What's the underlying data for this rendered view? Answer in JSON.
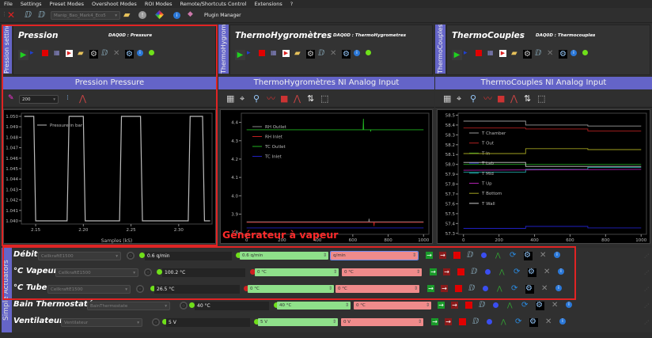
{
  "menu": [
    "File",
    "Settings",
    "Preset Modes",
    "Overshoot Modes",
    "ROI Modes",
    "Remote/Shortcuts Control",
    "Extensions",
    "?"
  ],
  "toolbar": {
    "preset_value": "Manip_Bao_Mark4_Eco5",
    "plugin_manager": "Plugin Manager"
  },
  "panels": [
    {
      "tab": "Pression settings",
      "title": "Pression",
      "daq": "DAQ0D : Pressure",
      "banner": "Pression Pressure",
      "refresh": "200"
    },
    {
      "tab": "ThermoHygromètres",
      "title": "ThermoHygromètres",
      "daq": "DAQ0D : ThermoHygrometres",
      "banner": "ThermoHygromètres NI Analog Input"
    },
    {
      "tab": "ThermoCouples settings",
      "title": "ThermoCouples",
      "daq": "DAQ0D : Thermocouples",
      "banner": "ThermoCouples NI Analog Input"
    }
  ],
  "annotation": "Générateur à vapeur",
  "chart_data": [
    {
      "type": "line",
      "xlabel": "Samples (kS)",
      "xlim": [
        2.135,
        2.335
      ],
      "ylim": [
        1.0397,
        1.0503
      ],
      "xticks": [
        2.15,
        2.2,
        2.25,
        2.3
      ],
      "xtick_labels": [
        "2.15",
        "2.20",
        "2.25",
        "2.30"
      ],
      "yticks": [
        1.04,
        1.041,
        1.042,
        1.043,
        1.044,
        1.045,
        1.046,
        1.047,
        1.048,
        1.049,
        1.05
      ],
      "ytick_labels": [
        "1.040",
        "1.041",
        "1.042",
        "1.043",
        "1.044",
        "1.045",
        "1.046",
        "1.047",
        "1.048",
        "1.049",
        "1.050"
      ],
      "legend": "top-left",
      "series": [
        {
          "name": "Pressure in bar",
          "color": "#bbbbbb",
          "x": [
            2.138,
            2.148,
            2.15,
            2.183,
            2.185,
            2.2,
            2.202,
            2.238,
            2.24,
            2.26,
            2.262,
            2.31,
            2.312,
            2.325,
            2.327,
            2.333
          ],
          "y": [
            1.05,
            1.05,
            1.04,
            1.04,
            1.05,
            1.05,
            1.04,
            1.04,
            1.05,
            1.05,
            1.04,
            1.04,
            1.05,
            1.05,
            1.04,
            1.04
          ]
        }
      ]
    },
    {
      "type": "line",
      "xlabel": "",
      "xlim": [
        -30,
        1030
      ],
      "ylim": [
        3.79,
        4.45
      ],
      "xticks": [
        0,
        200,
        400,
        600,
        800,
        1000
      ],
      "xtick_labels": [
        "0",
        "200",
        "400",
        "600",
        "800",
        "1000"
      ],
      "yticks": [
        3.8,
        3.9,
        4.0,
        4.1,
        4.2,
        4.3,
        4.4
      ],
      "ytick_labels": [
        "3.8",
        "3.9",
        "4.0",
        "4.1",
        "4.2",
        "4.3",
        "4.4"
      ],
      "legend": "top-left",
      "series": [
        {
          "name": "RH Outlet",
          "color": "#888888",
          "x": [
            0,
            690,
            692,
            694,
            1000
          ],
          "y": [
            3.858,
            3.858,
            3.875,
            3.858,
            3.858
          ]
        },
        {
          "name": "RH Inlet",
          "color": "#c02020",
          "x": [
            0,
            718,
            720,
            722,
            1000
          ],
          "y": [
            3.855,
            3.855,
            3.835,
            3.855,
            3.855
          ]
        },
        {
          "name": "TC Outlet",
          "color": "#20b020",
          "x": [
            0,
            658,
            660,
            662,
            700,
            701,
            702,
            1000
          ],
          "y": [
            4.36,
            4.36,
            4.42,
            4.36,
            4.36,
            4.35,
            4.36,
            4.36
          ]
        },
        {
          "name": "TC Inlet",
          "color": "#2020c0",
          "x": [
            0,
            1000
          ],
          "y": [
            3.825,
            3.825
          ]
        }
      ]
    },
    {
      "type": "line",
      "xlabel": "",
      "xlim": [
        -30,
        1030
      ],
      "ylim": [
        57.29,
        58.52
      ],
      "xticks": [
        0,
        200,
        400,
        600,
        800,
        1000
      ],
      "xtick_labels": [
        "0",
        "200",
        "400",
        "600",
        "800",
        "1000"
      ],
      "yticks": [
        57.3,
        57.4,
        57.5,
        57.6,
        57.7,
        57.8,
        57.9,
        58.0,
        58.1,
        58.2,
        58.3,
        58.4,
        58.5
      ],
      "ytick_labels": [
        "57.3",
        "57.4",
        "57.5",
        "57.6",
        "57.7",
        "57.8",
        "57.9",
        "58.0",
        "58.1",
        "58.2",
        "58.3",
        "58.4",
        "58.5"
      ],
      "legend": "top-left",
      "series": [
        {
          "name": "T Chamber",
          "color": "#999999",
          "x": [
            0,
            350,
            350,
            700,
            700,
            1000
          ],
          "y": [
            58.44,
            58.44,
            58.4,
            58.4,
            58.39,
            58.39
          ]
        },
        {
          "name": "T Out",
          "color": "#b02020",
          "x": [
            0,
            350,
            350,
            700,
            700,
            1000
          ],
          "y": [
            58.37,
            58.37,
            58.36,
            58.36,
            58.34,
            58.34
          ]
        },
        {
          "name": "T In",
          "color": "#20a020",
          "x": [
            0,
            1000
          ],
          "y": [
            58.0,
            58.0
          ]
        },
        {
          "name": "T Lab",
          "color": "#2020c0",
          "x": [
            0,
            350,
            350,
            700,
            700,
            1000
          ],
          "y": [
            57.35,
            57.35,
            57.37,
            57.37,
            57.355,
            57.355
          ]
        },
        {
          "name": "T Mid",
          "color": "#20a0a0",
          "x": [
            0,
            350,
            350,
            700,
            700,
            1000
          ],
          "y": [
            57.92,
            57.92,
            57.95,
            57.95,
            57.97,
            57.97
          ]
        },
        {
          "name": "T Up",
          "color": "#b020b0",
          "x": [
            0,
            1000
          ],
          "y": [
            57.94,
            57.95
          ]
        },
        {
          "name": "T Bottom",
          "color": "#a0a020",
          "x": [
            0,
            350,
            350,
            700,
            700,
            1000
          ],
          "y": [
            58.11,
            58.11,
            58.16,
            58.16,
            58.15,
            58.15
          ]
        },
        {
          "name": "T Wall",
          "color": "#cccccc",
          "x": [
            0,
            350,
            350,
            700,
            700,
            1000
          ],
          "y": [
            58.02,
            58.02,
            57.98,
            57.98,
            57.98,
            57.98
          ]
        }
      ]
    }
  ],
  "actuators": {
    "tab": "Simple Actuators",
    "rows": [
      {
        "name": "Débit",
        "device": "CellkraftE1500",
        "current": "0.6 q/min",
        "current_led": "#6fe01a",
        "target_led": "#6fe01a",
        "target": "0.6 q/min",
        "setpoint": "q/min"
      },
      {
        "name": "°C Vapeur",
        "device": "CellkraftE1500",
        "current": "100.2 °C",
        "current_led": "#6fe01a",
        "target_led": "#d02020",
        "target": "0 °C",
        "setpoint": "0 °C"
      },
      {
        "name": "°C Tube",
        "device": "CellkraftE1500",
        "current": "26.5 °C",
        "current_led": "#6fe01a",
        "target_led": "#d02020",
        "target": "0 °C",
        "setpoint": "0 °C"
      },
      {
        "name": "Bain Thermostaté",
        "device": "BainThermostate",
        "current": "40 °C",
        "current_led": "#6fe01a",
        "target_led": "#6fe01a",
        "target": "40 °C",
        "setpoint": "0 °C"
      },
      {
        "name": "Ventilateur",
        "device": "Ventilateur",
        "current": "5 V",
        "current_led": "#6fe01a",
        "target_led": "#6fe01a",
        "target": "5 V",
        "setpoint": "0 V"
      }
    ]
  }
}
